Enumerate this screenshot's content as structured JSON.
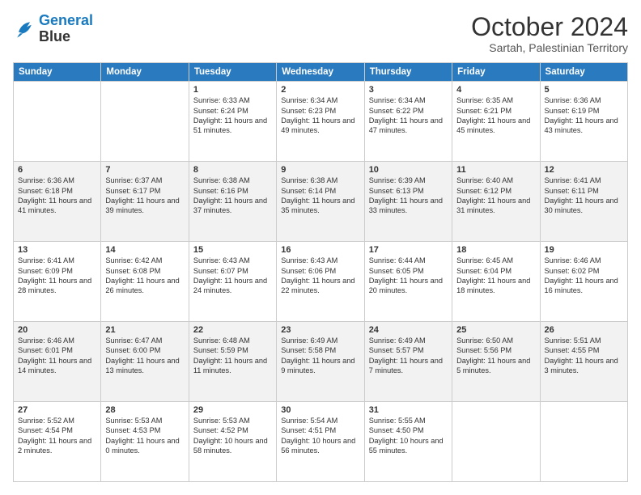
{
  "logo": {
    "line1": "General",
    "line2": "Blue"
  },
  "header": {
    "month": "October 2024",
    "location": "Sartah, Palestinian Territory"
  },
  "weekdays": [
    "Sunday",
    "Monday",
    "Tuesday",
    "Wednesday",
    "Thursday",
    "Friday",
    "Saturday"
  ],
  "rows": [
    [
      {
        "day": "",
        "lines": []
      },
      {
        "day": "",
        "lines": []
      },
      {
        "day": "1",
        "lines": [
          "Sunrise: 6:33 AM",
          "Sunset: 6:24 PM",
          "Daylight: 11 hours and 51 minutes."
        ]
      },
      {
        "day": "2",
        "lines": [
          "Sunrise: 6:34 AM",
          "Sunset: 6:23 PM",
          "Daylight: 11 hours and 49 minutes."
        ]
      },
      {
        "day": "3",
        "lines": [
          "Sunrise: 6:34 AM",
          "Sunset: 6:22 PM",
          "Daylight: 11 hours and 47 minutes."
        ]
      },
      {
        "day": "4",
        "lines": [
          "Sunrise: 6:35 AM",
          "Sunset: 6:21 PM",
          "Daylight: 11 hours and 45 minutes."
        ]
      },
      {
        "day": "5",
        "lines": [
          "Sunrise: 6:36 AM",
          "Sunset: 6:19 PM",
          "Daylight: 11 hours and 43 minutes."
        ]
      }
    ],
    [
      {
        "day": "6",
        "lines": [
          "Sunrise: 6:36 AM",
          "Sunset: 6:18 PM",
          "Daylight: 11 hours and 41 minutes."
        ]
      },
      {
        "day": "7",
        "lines": [
          "Sunrise: 6:37 AM",
          "Sunset: 6:17 PM",
          "Daylight: 11 hours and 39 minutes."
        ]
      },
      {
        "day": "8",
        "lines": [
          "Sunrise: 6:38 AM",
          "Sunset: 6:16 PM",
          "Daylight: 11 hours and 37 minutes."
        ]
      },
      {
        "day": "9",
        "lines": [
          "Sunrise: 6:38 AM",
          "Sunset: 6:14 PM",
          "Daylight: 11 hours and 35 minutes."
        ]
      },
      {
        "day": "10",
        "lines": [
          "Sunrise: 6:39 AM",
          "Sunset: 6:13 PM",
          "Daylight: 11 hours and 33 minutes."
        ]
      },
      {
        "day": "11",
        "lines": [
          "Sunrise: 6:40 AM",
          "Sunset: 6:12 PM",
          "Daylight: 11 hours and 31 minutes."
        ]
      },
      {
        "day": "12",
        "lines": [
          "Sunrise: 6:41 AM",
          "Sunset: 6:11 PM",
          "Daylight: 11 hours and 30 minutes."
        ]
      }
    ],
    [
      {
        "day": "13",
        "lines": [
          "Sunrise: 6:41 AM",
          "Sunset: 6:09 PM",
          "Daylight: 11 hours and 28 minutes."
        ]
      },
      {
        "day": "14",
        "lines": [
          "Sunrise: 6:42 AM",
          "Sunset: 6:08 PM",
          "Daylight: 11 hours and 26 minutes."
        ]
      },
      {
        "day": "15",
        "lines": [
          "Sunrise: 6:43 AM",
          "Sunset: 6:07 PM",
          "Daylight: 11 hours and 24 minutes."
        ]
      },
      {
        "day": "16",
        "lines": [
          "Sunrise: 6:43 AM",
          "Sunset: 6:06 PM",
          "Daylight: 11 hours and 22 minutes."
        ]
      },
      {
        "day": "17",
        "lines": [
          "Sunrise: 6:44 AM",
          "Sunset: 6:05 PM",
          "Daylight: 11 hours and 20 minutes."
        ]
      },
      {
        "day": "18",
        "lines": [
          "Sunrise: 6:45 AM",
          "Sunset: 6:04 PM",
          "Daylight: 11 hours and 18 minutes."
        ]
      },
      {
        "day": "19",
        "lines": [
          "Sunrise: 6:46 AM",
          "Sunset: 6:02 PM",
          "Daylight: 11 hours and 16 minutes."
        ]
      }
    ],
    [
      {
        "day": "20",
        "lines": [
          "Sunrise: 6:46 AM",
          "Sunset: 6:01 PM",
          "Daylight: 11 hours and 14 minutes."
        ]
      },
      {
        "day": "21",
        "lines": [
          "Sunrise: 6:47 AM",
          "Sunset: 6:00 PM",
          "Daylight: 11 hours and 13 minutes."
        ]
      },
      {
        "day": "22",
        "lines": [
          "Sunrise: 6:48 AM",
          "Sunset: 5:59 PM",
          "Daylight: 11 hours and 11 minutes."
        ]
      },
      {
        "day": "23",
        "lines": [
          "Sunrise: 6:49 AM",
          "Sunset: 5:58 PM",
          "Daylight: 11 hours and 9 minutes."
        ]
      },
      {
        "day": "24",
        "lines": [
          "Sunrise: 6:49 AM",
          "Sunset: 5:57 PM",
          "Daylight: 11 hours and 7 minutes."
        ]
      },
      {
        "day": "25",
        "lines": [
          "Sunrise: 6:50 AM",
          "Sunset: 5:56 PM",
          "Daylight: 11 hours and 5 minutes."
        ]
      },
      {
        "day": "26",
        "lines": [
          "Sunrise: 5:51 AM",
          "Sunset: 4:55 PM",
          "Daylight: 11 hours and 3 minutes."
        ]
      }
    ],
    [
      {
        "day": "27",
        "lines": [
          "Sunrise: 5:52 AM",
          "Sunset: 4:54 PM",
          "Daylight: 11 hours and 2 minutes."
        ]
      },
      {
        "day": "28",
        "lines": [
          "Sunrise: 5:53 AM",
          "Sunset: 4:53 PM",
          "Daylight: 11 hours and 0 minutes."
        ]
      },
      {
        "day": "29",
        "lines": [
          "Sunrise: 5:53 AM",
          "Sunset: 4:52 PM",
          "Daylight: 10 hours and 58 minutes."
        ]
      },
      {
        "day": "30",
        "lines": [
          "Sunrise: 5:54 AM",
          "Sunset: 4:51 PM",
          "Daylight: 10 hours and 56 minutes."
        ]
      },
      {
        "day": "31",
        "lines": [
          "Sunrise: 5:55 AM",
          "Sunset: 4:50 PM",
          "Daylight: 10 hours and 55 minutes."
        ]
      },
      {
        "day": "",
        "lines": []
      },
      {
        "day": "",
        "lines": []
      }
    ]
  ]
}
